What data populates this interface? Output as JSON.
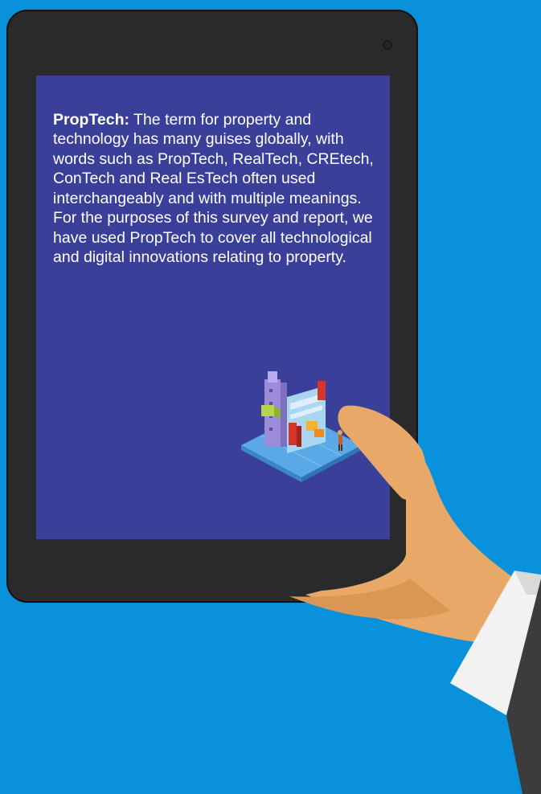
{
  "definition": {
    "term": "PropTech:",
    "text": " The term for property and technology has many guises globally, with words such as PropTech, RealTech, CREtech, ConTech and Real EsTech often used interchangeably and with multiple meanings. For the purposes of this survey and report, we have used PropTech to cover all technological and digital innovations relating to property."
  },
  "colors": {
    "background": "#0a91dc",
    "tablet_frame": "#2a2a2a",
    "screen": "#3a3f9a",
    "skin": "#e8a868",
    "cuff": "#f2f2f2",
    "sleeve": "#3c3c3c"
  },
  "icons": {
    "illustration": "building-blocks-illustration",
    "hand": "hand-icon"
  }
}
